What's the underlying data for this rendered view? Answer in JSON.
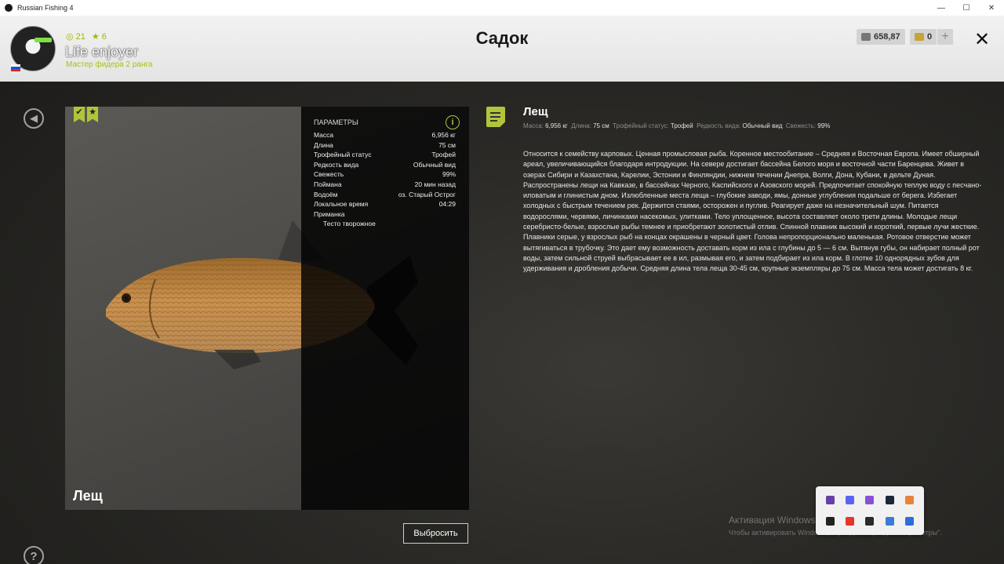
{
  "window": {
    "title": "Russian Fishing 4",
    "minimize": "—",
    "maximize": "☐",
    "close": "✕"
  },
  "header": {
    "stat_level": "◎ 21",
    "stat_stars": "★ 6",
    "username": "Life enjoyer",
    "rank": "Мастер фидера 2 ранга",
    "title": "Садок",
    "silver": "658,87",
    "gold": "0",
    "plus": "+",
    "close": "✕"
  },
  "fish": {
    "name": "Лещ",
    "params_title": "ПАРАМЕТРЫ",
    "info": "i",
    "badges": [
      "✔",
      "★"
    ],
    "params": [
      {
        "label": "Масса",
        "value": "6,956 кг"
      },
      {
        "label": "Длина",
        "value": "75 см"
      },
      {
        "label": "Трофейный статус",
        "value": "Трофей"
      },
      {
        "label": "Редкость вида",
        "value": "Обычный вид"
      },
      {
        "label": "Свежесть",
        "value": "99%"
      },
      {
        "label": "Поймана",
        "value": "20 мин назад"
      },
      {
        "label": "Водоём",
        "value": "оз. Старый Острог"
      },
      {
        "label": "Локальное время",
        "value": "04:29"
      }
    ],
    "bait_label": "Приманка",
    "bait_value": "Тесто творожное",
    "discard": "Выбросить"
  },
  "description": {
    "title": "Лещ",
    "meta": [
      {
        "label": "Масса:",
        "value": "6,956 кг"
      },
      {
        "label": "Длина:",
        "value": "75 см"
      },
      {
        "label": "Трофейный статус:",
        "value": "Трофей"
      },
      {
        "label": "Редкость вида:",
        "value": "Обычный вид"
      },
      {
        "label": "Свежесть:",
        "value": "99%"
      }
    ],
    "text": "Относится к семейству карповых. Ценная промысловая рыба. Коренное местообитание – Средняя и Восточная Европа. Имеет обширный ареал, увеличивающийся благодаря интродукции. На севере достигает бассейна Белого моря и восточной части Баренцева. Живет в озерах Сибири и Казахстана, Карелии, Эстонии и Финляндии, нижнем течении Днепра, Волги, Дона, Кубани, в дельте Дуная. Распространены лещи на Кавказе, в бассейнах Черного, Каспийского и Азовского морей. Предпочитает спокойную теплую воду с песчано-иловатым и глинистым дном. Излюбленные места леща – глубокие заводи, ямы, донные углубления подальше от берега. Избегает холодных с быстрым течением рек. Держится стаями, осторожен и пуглив. Реагирует даже на незначительный шум. Питается водорослями, червями, личинками насекомых, улитками. Тело уплощенное, высота составляет около трети длины. Молодые лещи серебристо-белые, взрослые рыбы темнее и приобретают золотистый отлив. Спинной плавник высокий и короткий, первые лучи жесткие. Плавники серые, у взрослых рыб на концах окрашены в черный цвет. Голова непропорционально маленькая. Ротовое отверстие может вытягиваться в трубочку. Это дает ему возможность доставать корм из ила с глубины до 5 — 6 см. Вытянув губы, он набирает полный рот воды, затем сильной струей выбрасывает ее в ил, размывая его, и затем подбирает из ила корм. В глотке 10 однорядных зубов для удерживания и дробления добычи. Средняя длина тела леща 30-45 см, крупные экземпляры до 75 см. Масса тела может достигать 8 кг."
  },
  "side": {
    "back": "◀",
    "help": "?"
  },
  "os": {
    "activation_title": "Активация Windows",
    "activation_text": "Чтобы активировать Windows, перейдите в раздел \"Параметры\"."
  },
  "tray_icons": [
    {
      "name": "twitch-icon",
      "color": "#6441a5"
    },
    {
      "name": "discord-icon",
      "color": "#5865f2"
    },
    {
      "name": "feather-icon",
      "color": "#8a4fd8"
    },
    {
      "name": "steam-icon",
      "color": "#1b2838"
    },
    {
      "name": "orange-app-icon",
      "color": "#e8833a"
    },
    {
      "name": "obs-icon",
      "color": "#222222"
    },
    {
      "name": "yandex-icon",
      "color": "#e8342a"
    },
    {
      "name": "epic-icon",
      "color": "#2a2a2a"
    },
    {
      "name": "monitor-icon",
      "color": "#3a7bd5"
    },
    {
      "name": "bluetooth-icon",
      "color": "#2a6fdb"
    }
  ],
  "colors": {
    "accent": "#b3c43a",
    "header_bg": "#ececec"
  }
}
